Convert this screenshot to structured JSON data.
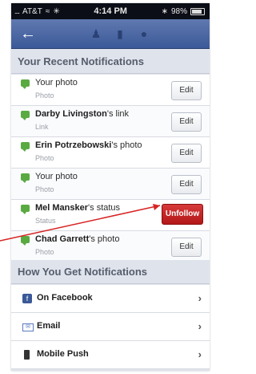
{
  "status_bar": {
    "signal": "....",
    "carrier": "AT&T",
    "time": "4:14 PM",
    "battery": "98%"
  },
  "nav": {
    "back_icon": "back-arrow-icon",
    "icons": [
      "friends-icon",
      "messages-icon",
      "globe-icon"
    ]
  },
  "recent": {
    "heading": "Your Recent Notifications",
    "items": [
      {
        "name": "",
        "suffix": "Your photo",
        "sub": "Photo",
        "action": "Edit"
      },
      {
        "name": "Darby Livingston",
        "suffix": "'s link",
        "sub": "Link",
        "action": "Edit"
      },
      {
        "name": "Erin Potrzebowski",
        "suffix": "'s photo",
        "sub": "Photo",
        "action": "Edit"
      },
      {
        "name": "",
        "suffix": "Your photo",
        "sub": "Photo",
        "action": "Edit"
      },
      {
        "name": "Mel Mansker",
        "suffix": "'s status",
        "sub": "Status",
        "action": "Unfollow"
      },
      {
        "name": "Chad Garrett",
        "suffix": "'s photo",
        "sub": "Photo",
        "action": "Edit"
      }
    ]
  },
  "how": {
    "heading": "How You Get Notifications",
    "items": [
      {
        "label": "On Facebook",
        "icon": "facebook-icon"
      },
      {
        "label": "Email",
        "icon": "envelope-icon"
      },
      {
        "label": "Mobile Push",
        "icon": "phone-icon"
      }
    ]
  },
  "colors": {
    "nav": "#3b5998",
    "unfollow": "#c32222",
    "chat_icon": "#5aaa42",
    "arrow": "#d82424"
  }
}
